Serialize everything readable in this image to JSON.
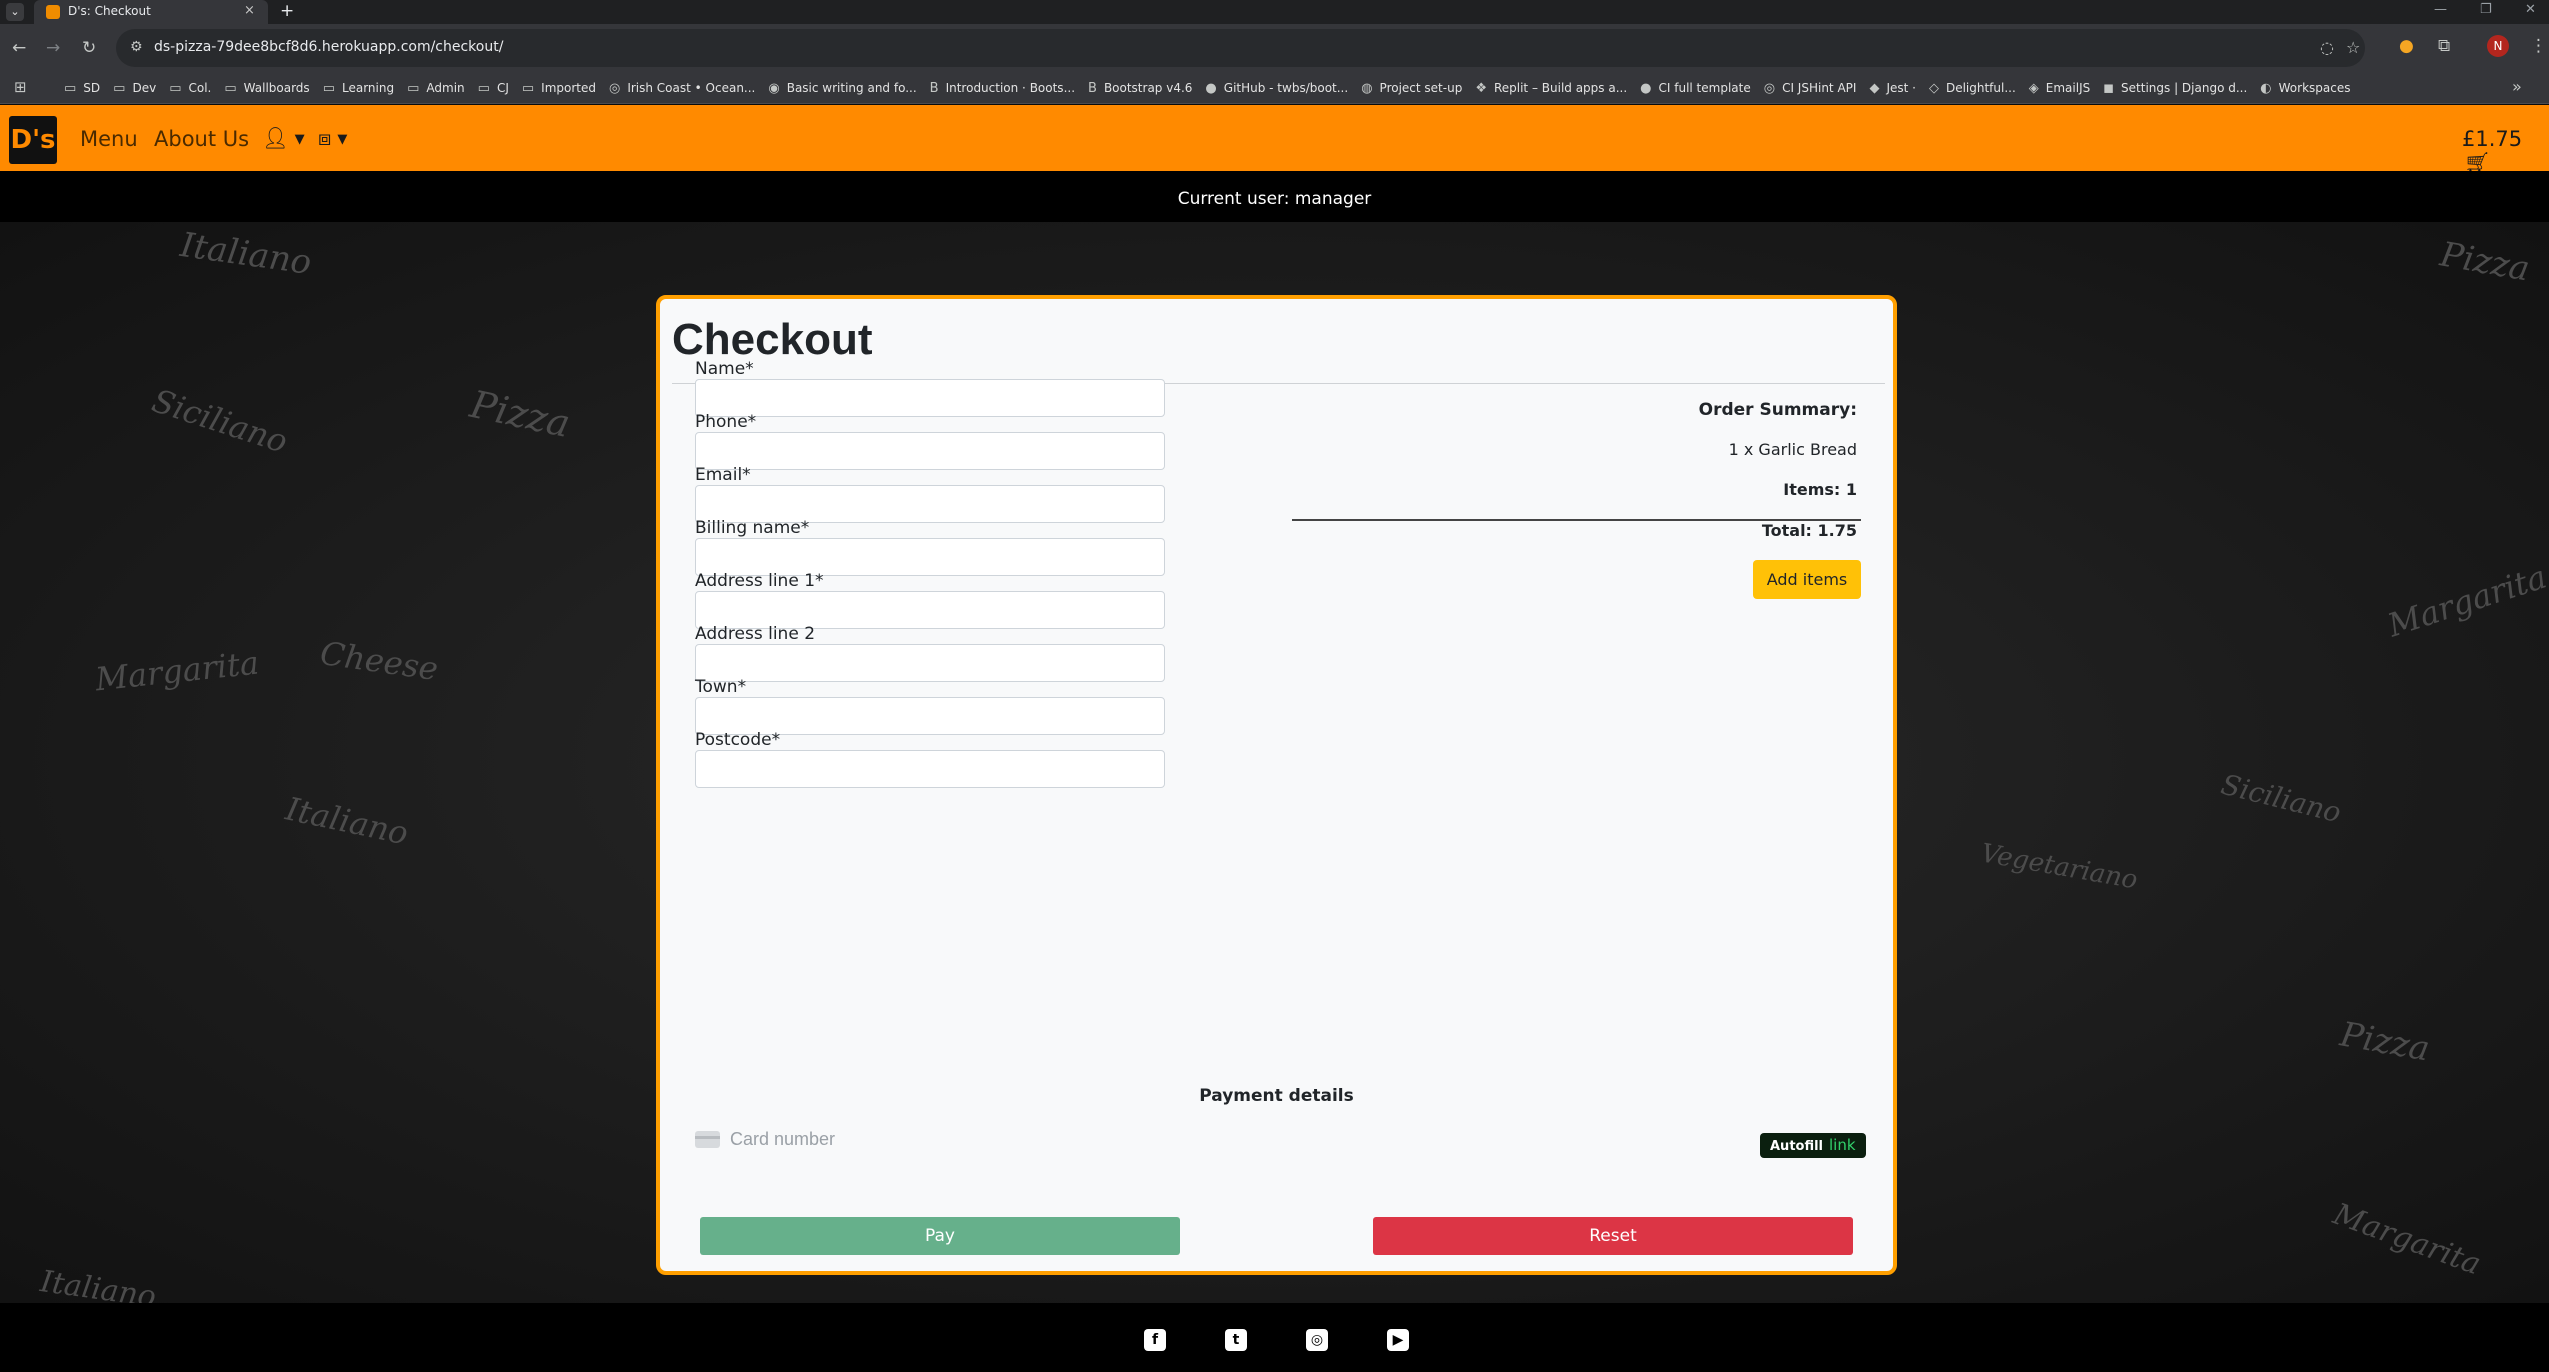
{
  "browser": {
    "tab_title": "D's: Checkout",
    "tab_close": "×",
    "new_tab": "+",
    "url": "ds-pizza-79dee8bcf8d6.herokuapp.com/checkout/",
    "profile_initial": "N",
    "bookmarks": [
      {
        "icon": "folder-icon",
        "glyph": "▭",
        "label": "SD"
      },
      {
        "icon": "folder-icon",
        "glyph": "▭",
        "label": "Dev"
      },
      {
        "icon": "folder-icon",
        "glyph": "▭",
        "label": "Col."
      },
      {
        "icon": "folder-icon",
        "glyph": "▭",
        "label": "Wallboards"
      },
      {
        "icon": "folder-icon",
        "glyph": "▭",
        "label": "Learning"
      },
      {
        "icon": "folder-icon",
        "glyph": "▭",
        "label": "Admin"
      },
      {
        "icon": "folder-icon",
        "glyph": "▭",
        "label": "CJ"
      },
      {
        "icon": "folder-icon",
        "glyph": "▭",
        "label": "Imported"
      },
      {
        "icon": "site-icon",
        "glyph": "◎",
        "label": "Irish Coast • Ocean..."
      },
      {
        "icon": "site-icon",
        "glyph": "◉",
        "label": "Basic writing and fo..."
      },
      {
        "icon": "bootstrap-icon",
        "glyph": "B",
        "label": "Introduction · Boots..."
      },
      {
        "icon": "bootstrap-icon",
        "glyph": "B",
        "label": "Bootstrap v4.6"
      },
      {
        "icon": "github-icon",
        "glyph": "●",
        "label": "GitHub - twbs/boot..."
      },
      {
        "icon": "site-icon",
        "glyph": "◍",
        "label": "Project set-up"
      },
      {
        "icon": "replit-icon",
        "glyph": "❖",
        "label": "Replit – Build apps a..."
      },
      {
        "icon": "github-icon",
        "glyph": "●",
        "label": "CI full template"
      },
      {
        "icon": "site-icon",
        "glyph": "◎",
        "label": "CI JSHint API"
      },
      {
        "icon": "site-icon",
        "glyph": "◆",
        "label": "Jest ·"
      },
      {
        "icon": "site-icon",
        "glyph": "◇",
        "label": "Delightful..."
      },
      {
        "icon": "site-icon",
        "glyph": "◈",
        "label": "EmailJS"
      },
      {
        "icon": "site-icon",
        "glyph": "◼",
        "label": "Settings | Django d..."
      },
      {
        "icon": "site-icon",
        "glyph": "◐",
        "label": "Workspaces"
      }
    ]
  },
  "site": {
    "logo": "D's",
    "nav": {
      "menu": "Menu",
      "about": "About Us",
      "basket_total": "£1.75"
    },
    "current_user": "Current user: manager"
  },
  "checkout": {
    "title": "Checkout",
    "fields": [
      {
        "key": "name",
        "label": "Name*"
      },
      {
        "key": "phone",
        "label": "Phone*"
      },
      {
        "key": "email",
        "label": "Email*"
      },
      {
        "key": "billing-name",
        "label": "Billing name*"
      },
      {
        "key": "address-line-1",
        "label": "Address line 1*"
      },
      {
        "key": "address-line-2",
        "label": "Address line 2"
      },
      {
        "key": "town",
        "label": "Town*"
      },
      {
        "key": "postcode",
        "label": "Postcode*"
      }
    ],
    "summary": {
      "heading": "Order Summary:",
      "item": "1 x Garlic Bread",
      "items_count": "Items: 1",
      "total": "Total: 1.75",
      "add_items": "Add items"
    },
    "payment": {
      "heading": "Payment details",
      "card_placeholder": "Card number",
      "autofill_label": "Autofill",
      "autofill_link": "link"
    },
    "pay_button": "Pay",
    "reset_button": "Reset"
  },
  "colors": {
    "brand_orange": "#ff8a00",
    "card_border": "#ff9f00",
    "pay_green": "#66b08b",
    "reset_red": "#dc3545",
    "add_items_yellow": "#ffc107"
  },
  "footer": {
    "social": [
      {
        "icon": "facebook-icon",
        "glyph": "f"
      },
      {
        "icon": "twitter-icon",
        "glyph": "t"
      },
      {
        "icon": "instagram-icon",
        "glyph": "◎"
      },
      {
        "icon": "youtube-icon",
        "glyph": "▶"
      }
    ]
  }
}
